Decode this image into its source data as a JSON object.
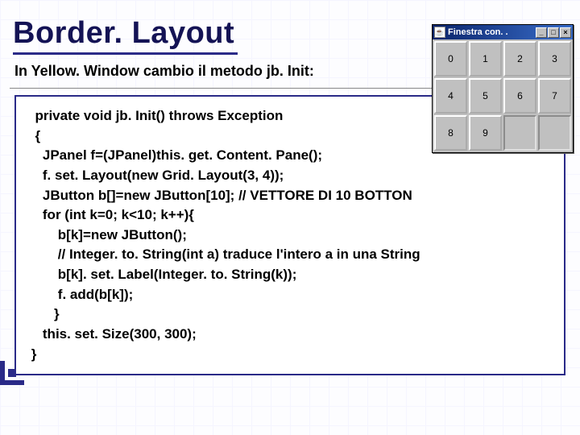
{
  "title": "Border. Layout",
  "subtitle": "In Yellow. Window cambio il metodo jb. Init:",
  "code": "  private void jb. Init() throws Exception\n  {\n    JPanel f=(JPanel)this. get. Content. Pane();\n    f. set. Layout(new Grid. Layout(3, 4));\n    JButton b[]=new JButton[10]; // VETTORE DI 10 BOTTON\n    for (int k=0; k<10; k++){\n        b[k]=new JButton();\n        // Integer. to. String(int a) traduce l'intero a in una String\n        b[k]. set. Label(Integer. to. String(k));\n        f. add(b[k]);\n       }\n    this. set. Size(300, 300);\n }",
  "java_window": {
    "title": "Finestra con. .",
    "btn_min": "_",
    "btn_max": "□",
    "btn_close": "×",
    "cells": [
      "0",
      "1",
      "2",
      "3",
      "4",
      "5",
      "6",
      "7",
      "8",
      "9",
      "",
      ""
    ]
  }
}
